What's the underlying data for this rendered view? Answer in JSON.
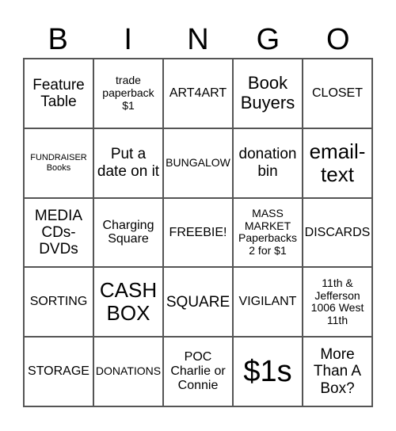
{
  "header": [
    "B",
    "I",
    "N",
    "G",
    "O"
  ],
  "cells": [
    [
      {
        "text": "Feature Table",
        "size": "s-l"
      },
      {
        "text": "trade paperback $1",
        "size": "s-s"
      },
      {
        "text": "ART4ART",
        "size": "s-m"
      },
      {
        "text": "Book Buyers",
        "size": "s-xl"
      },
      {
        "text": "CLOSET",
        "size": "s-m"
      }
    ],
    [
      {
        "text": "FUNDRAISER Books",
        "size": "s-xs"
      },
      {
        "text": "Put a date on it",
        "size": "s-l"
      },
      {
        "text": "BUNGALOW",
        "size": "s-s"
      },
      {
        "text": "donation bin",
        "size": "s-l"
      },
      {
        "text": "email-text",
        "size": "s-xxl"
      }
    ],
    [
      {
        "text": "MEDIA CDs-DVDs",
        "size": "s-l"
      },
      {
        "text": "Charging Square",
        "size": "s-m"
      },
      {
        "text": "FREEBIE!",
        "size": "s-m"
      },
      {
        "text": "MASS MARKET Paperbacks 2 for $1",
        "size": "s-s"
      },
      {
        "text": "DISCARDS",
        "size": "s-m"
      }
    ],
    [
      {
        "text": "SORTING",
        "size": "s-m"
      },
      {
        "text": "CASH BOX",
        "size": "s-xxl"
      },
      {
        "text": "SQUARE",
        "size": "s-l"
      },
      {
        "text": "VIGILANT",
        "size": "s-m"
      },
      {
        "text": "11th & Jefferson 1006 West 11th",
        "size": "s-s"
      }
    ],
    [
      {
        "text": "STORAGE",
        "size": "s-m"
      },
      {
        "text": "DONATIONS",
        "size": "s-s"
      },
      {
        "text": "POC Charlie or Connie",
        "size": "s-m"
      },
      {
        "text": "$1s",
        "size": "s-huge"
      },
      {
        "text": "More Than A Box?",
        "size": "s-l"
      }
    ]
  ]
}
